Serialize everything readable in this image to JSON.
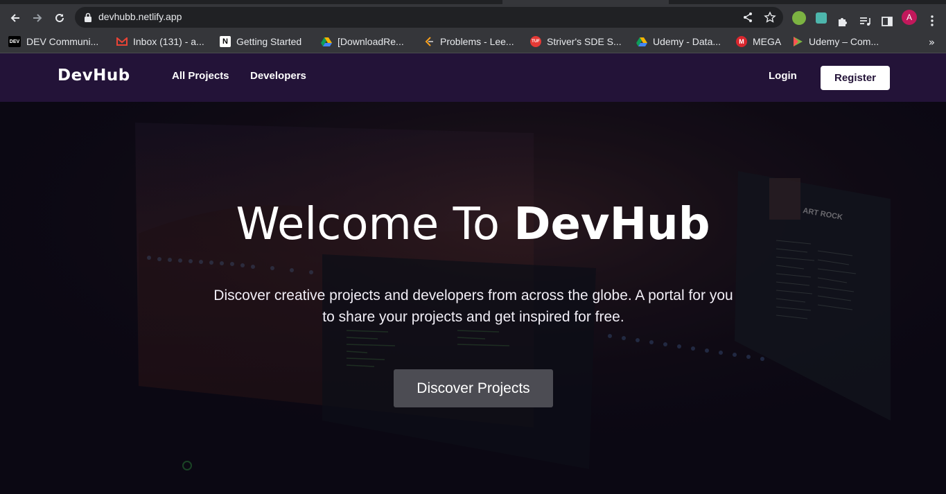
{
  "browser": {
    "url": "devhubb.netlify.app",
    "avatar_letter": "A",
    "bookmarks": [
      {
        "label": "DEV Communi...",
        "icon": "dev-icon",
        "color": "#000000"
      },
      {
        "label": "Inbox (131) - a...",
        "icon": "gmail-icon",
        "color": "#ea4335"
      },
      {
        "label": "Getting Started",
        "icon": "notion-icon",
        "color": "#ffffff"
      },
      {
        "label": "[DownloadRe...",
        "icon": "google-drive-icon",
        "color": "#1fa463"
      },
      {
        "label": "Problems - Lee...",
        "icon": "leetcode-icon",
        "color": "#f89f1b"
      },
      {
        "label": "Striver's SDE S...",
        "icon": "tuf-icon",
        "color": "#e53935"
      },
      {
        "label": "Udemy - Data...",
        "icon": "google-drive-icon",
        "color": "#1fa463"
      },
      {
        "label": "MEGA",
        "icon": "mega-icon",
        "color": "#d9272e"
      },
      {
        "label": "Udemy – Com...",
        "icon": "play-icon",
        "color": "#7cb342"
      }
    ]
  },
  "header": {
    "logo": "DevHub",
    "nav": [
      "All Projects",
      "Developers"
    ],
    "login": "Login",
    "register": "Register",
    "bg_color": "#231338"
  },
  "hero": {
    "title_light": "Welcome To ",
    "title_bold": "DevHub",
    "subtitle": "Discover creative projects and developers from across the globe. A portal for you to share your projects and get inspired for free.",
    "cta": "Discover Projects"
  },
  "artwork_text": {
    "album": "ART ROCK"
  }
}
